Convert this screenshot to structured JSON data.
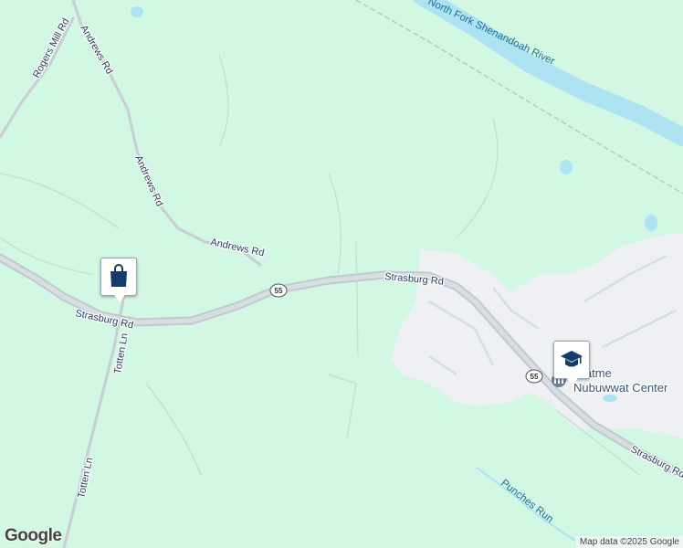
{
  "map": {
    "roads": {
      "strasburg_rd": "Strasburg Rd",
      "andrews_rd": "Andrews Rd",
      "rogers_mill_rd": "Rogers Mill Rd",
      "totten_ln": "Totten Ln",
      "route_number": "55"
    },
    "water": {
      "river": "North Fork Shenandoah River",
      "creek": "Punches Run"
    },
    "poi": {
      "center_name_line1": "Ahatme",
      "center_name_line2": "Nubuwwat Center"
    },
    "markers": [
      {
        "name": "shopping",
        "icon": "shopping-bag-icon"
      },
      {
        "name": "school",
        "icon": "graduation-cap-icon"
      }
    ],
    "colors": {
      "land": "#d2f7e3",
      "water": "#aee3f4",
      "road": "#c8ced4",
      "urban": "#eef0f3",
      "marker_icon": "#123d6b"
    }
  },
  "footer": {
    "logo": "Google",
    "attribution": "Map data ©2025 Google"
  }
}
